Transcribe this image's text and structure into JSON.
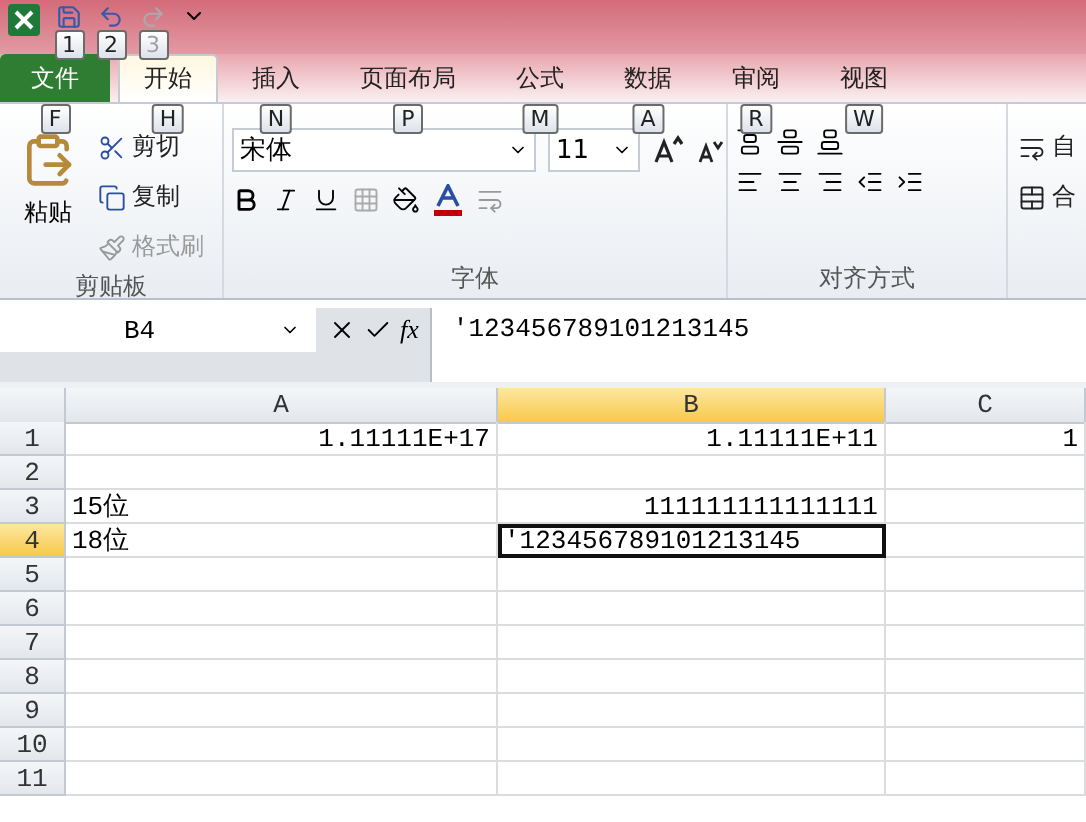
{
  "quick_access": {
    "keytips": [
      {
        "label": "1",
        "disabled": false
      },
      {
        "label": "2",
        "disabled": false
      },
      {
        "label": "3",
        "disabled": true
      }
    ]
  },
  "tabs": [
    {
      "label": "文件",
      "kind": "file",
      "selected": false,
      "keytip": "F"
    },
    {
      "label": "开始",
      "kind": "tab",
      "selected": true,
      "keytip": "H"
    },
    {
      "label": "插入",
      "kind": "tab",
      "selected": false,
      "keytip": "N"
    },
    {
      "label": "页面布局",
      "kind": "tab",
      "selected": false,
      "keytip": "P"
    },
    {
      "label": "公式",
      "kind": "tab",
      "selected": false,
      "keytip": "M"
    },
    {
      "label": "数据",
      "kind": "tab",
      "selected": false,
      "keytip": "A"
    },
    {
      "label": "审阅",
      "kind": "tab",
      "selected": false,
      "keytip": "R"
    },
    {
      "label": "视图",
      "kind": "tab",
      "selected": false,
      "keytip": "W"
    }
  ],
  "ribbon": {
    "clipboard": {
      "title": "剪贴板",
      "paste": "粘贴",
      "cut": "剪切",
      "copy": "复制",
      "format_painter": {
        "label": "格式刷",
        "disabled": true
      }
    },
    "font": {
      "title": "字体",
      "name": "宋体",
      "size": "11"
    },
    "alignment": {
      "title": "对齐方式",
      "wrap_text": "自",
      "merge": "合"
    }
  },
  "formula_bar": {
    "name_box": "B4",
    "function_label": "fx",
    "formula": "'123456789101213145"
  },
  "sheet": {
    "columns": [
      {
        "label": "A",
        "selected": false
      },
      {
        "label": "B",
        "selected": true
      },
      {
        "label": "C",
        "selected": false
      }
    ],
    "rows": [
      {
        "label": "1",
        "selected": false,
        "cells": [
          {
            "kind": "number",
            "text": "1.11111E+17",
            "selected": false
          },
          {
            "kind": "number",
            "text": "1.11111E+11",
            "selected": false
          },
          {
            "kind": "number",
            "text": "1",
            "selected": false
          }
        ]
      },
      {
        "label": "2",
        "selected": false,
        "cells": []
      },
      {
        "label": "3",
        "selected": false,
        "cells": [
          {
            "kind": "text",
            "text": "15位",
            "selected": false
          },
          {
            "kind": "number",
            "text": "111111111111111",
            "selected": false
          }
        ]
      },
      {
        "label": "4",
        "selected": true,
        "cells": [
          {
            "kind": "text",
            "text": "18位",
            "selected": false
          },
          {
            "kind": "text",
            "text": "'123456789101213145",
            "selected": true
          }
        ]
      },
      {
        "label": "5",
        "selected": false,
        "cells": []
      },
      {
        "label": "6",
        "selected": false,
        "cells": []
      },
      {
        "label": "7",
        "selected": false,
        "cells": []
      },
      {
        "label": "8",
        "selected": false,
        "cells": []
      },
      {
        "label": "9",
        "selected": false,
        "cells": []
      },
      {
        "label": "10",
        "selected": false,
        "cells": []
      },
      {
        "label": "11",
        "selected": false,
        "cells": []
      }
    ]
  }
}
